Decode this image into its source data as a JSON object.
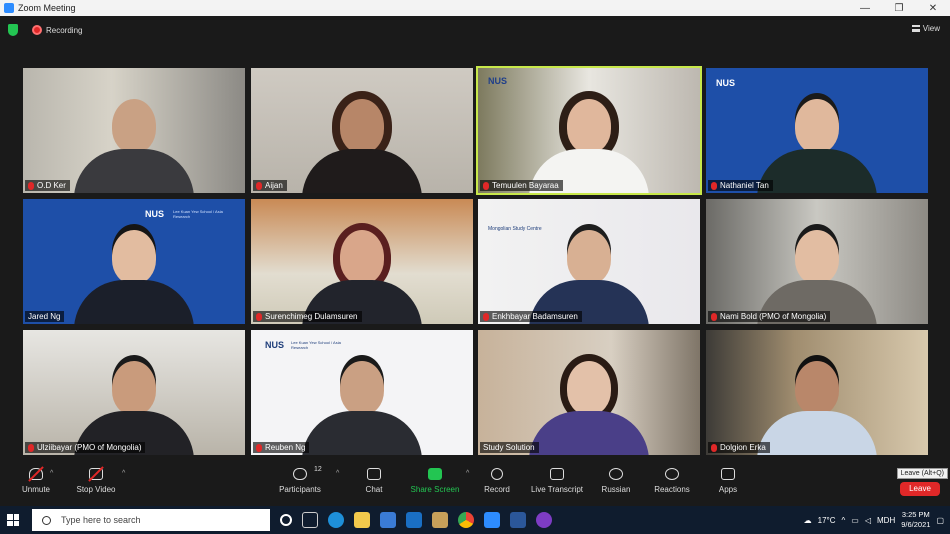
{
  "window": {
    "title": "Zoom Meeting"
  },
  "meeting": {
    "recording_label": "Recording",
    "view_label": "View"
  },
  "participants": [
    {
      "name": "O.D Ker",
      "muted": true
    },
    {
      "name": "Aijan",
      "muted": true
    },
    {
      "name": "Temuulen Bayaraa",
      "muted": true,
      "active": true
    },
    {
      "name": "Nathaniel Tan",
      "muted": true
    },
    {
      "name": "Jared Ng",
      "muted": false
    },
    {
      "name": "Surenchimeg Dulamsuren",
      "muted": true
    },
    {
      "name": "Enkhbayar Badamsuren",
      "muted": true
    },
    {
      "name": "Nami Bold (PMO of Mongolia)",
      "muted": true
    },
    {
      "name": "Ulziibayar (PMO of Mongolia)",
      "muted": true
    },
    {
      "name": "Reuben Ng",
      "muted": true
    },
    {
      "name": "Study Solution",
      "muted": false
    },
    {
      "name": "Dolgion Erka",
      "muted": true
    }
  ],
  "tile_logos": {
    "nus": "NUS",
    "nus_sub": "Lee Kuan Yew School / Asia Research",
    "mongolia_card": "Mongolian Study Centre"
  },
  "toolbar": {
    "unmute": "Unmute",
    "stop_video": "Stop Video",
    "participants": "Participants",
    "participants_count": "12",
    "chat": "Chat",
    "share_screen": "Share Screen",
    "record": "Record",
    "live_transcript": "Live Transcript",
    "language": "Russian",
    "reactions": "Reactions",
    "apps": "Apps",
    "leave": "Leave",
    "leave_tooltip": "Leave (Alt+Q)"
  },
  "taskbar": {
    "search_placeholder": "Type here to search",
    "temperature": "17°C",
    "input_lang": "MDH",
    "time": "3:25 PM",
    "date": "9/6/2021"
  },
  "colors": {
    "accent_green": "#23c552",
    "record_red": "#e02828",
    "active_speaker": "#c8e84a"
  }
}
